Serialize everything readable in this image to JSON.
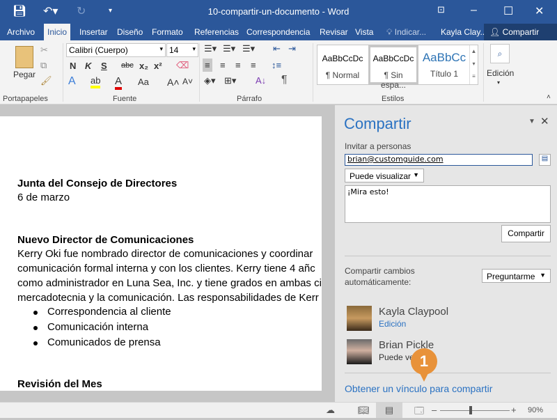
{
  "window": {
    "title": "10-compartir-un-documento - Word"
  },
  "tabs": [
    "Archivo",
    "Inicio",
    "Insertar",
    "Diseño",
    "Formato",
    "Referencias",
    "Correspondencia",
    "Revisar",
    "Vista",
    "Indicar...",
    "Kayla Clay..."
  ],
  "share_tab": "Compartir",
  "ribbon": {
    "paste": "Pegar",
    "font": "Calibri (Cuerpo)",
    "size": "14",
    "font_buttons": [
      "N",
      "K",
      "S",
      "abc",
      "x₂",
      "x²"
    ],
    "case": "Aa",
    "styles": [
      {
        "preview": "AaBbCcDc",
        "name": "¶ Normal"
      },
      {
        "preview": "AaBbCcDc",
        "name": "¶ Sin espa..."
      },
      {
        "preview": "AaBbCc",
        "name": "Título 1"
      }
    ],
    "edit": "Edición",
    "groups": [
      "Portapapeles",
      "Fuente",
      "Párrafo",
      "Estilos"
    ]
  },
  "document": {
    "lines": [
      {
        "text": "Junta del Consejo de Directores",
        "bold": true
      },
      {
        "text": "6 de marzo",
        "bold": false
      },
      {
        "text": "Nuevo Director de Comunicaciones",
        "bold": true
      },
      {
        "text": "Kerry Oki fue nombrado director de comunicaciones y coordinar",
        "bold": false
      },
      {
        "text": "comunicación formal interna y con los clientes. Kerry tiene 4 añc",
        "bold": false
      },
      {
        "text": "como administrador en Luna Sea, Inc. y tiene grados en ambas ci",
        "bold": false
      },
      {
        "text": "mercadotecnia y la comunicación. Las responsabilidades de Kerr",
        "bold": false
      },
      {
        "text": "Revisión del Mes",
        "bold": true
      }
    ],
    "bullets": [
      "Correspondencia al cliente",
      "Comunicación interna",
      "Comunicados de prensa"
    ]
  },
  "pane": {
    "title": "Compartir",
    "invite_label": "Invitar a personas",
    "email": "brian@customguide.com",
    "permission": "Puede visualizar",
    "message": "¡Mira esto!",
    "share_button": "Compartir",
    "auto_label_1": "Compartir cambios",
    "auto_label_2": "automáticamente:",
    "auto_value": "Preguntarme",
    "people": [
      {
        "name": "Kayla Claypool",
        "role": "Edición"
      },
      {
        "name": "Brian Pickle",
        "role": "Puede ver"
      }
    ],
    "link": "Obtener un vínculo para compartir"
  },
  "callout": "1",
  "status": {
    "zoom": "90%",
    "zoom_level": 90
  }
}
